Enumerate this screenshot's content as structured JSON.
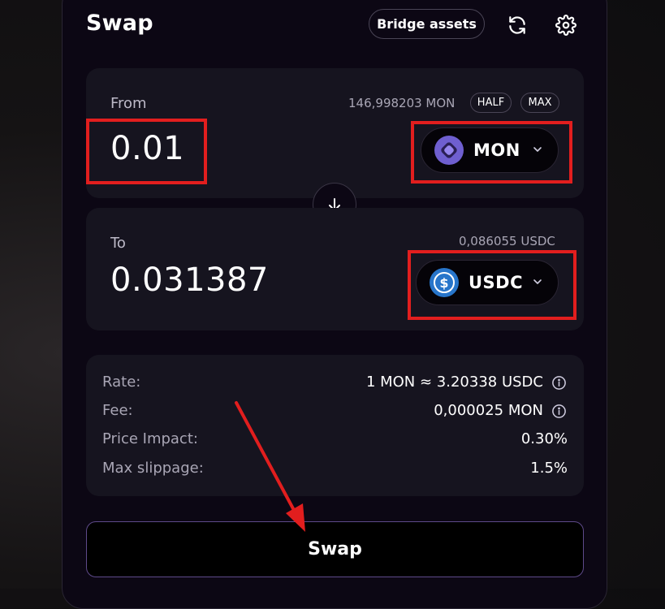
{
  "header": {
    "title": "Swap",
    "bridge_label": "Bridge assets",
    "refresh_icon": "refresh-icon",
    "settings_icon": "gear-icon"
  },
  "from": {
    "label": "From",
    "balance": "146,998203 MON",
    "half_label": "HALF",
    "max_label": "MAX",
    "amount": "0.01",
    "token": "MON",
    "token_color": "#7b68d9"
  },
  "to": {
    "label": "To",
    "balance": "0,086055 USDC",
    "amount": "0.031387",
    "token": "USDC",
    "token_color": "#2775ca"
  },
  "info": {
    "rate_label": "Rate:",
    "rate_value": "1 MON ≈ 3.20338 USDC",
    "fee_label": "Fee:",
    "fee_value": "0,000025 MON",
    "impact_label": "Price Impact:",
    "impact_value": "0.30%",
    "slippage_label": "Max slippage:",
    "slippage_value": "1.5%"
  },
  "swap_button_label": "Swap",
  "colors": {
    "background": "#0c0714",
    "panel": "#16141f",
    "accent_border": "#5e4a8a",
    "annotation_red": "#e21e1e"
  }
}
